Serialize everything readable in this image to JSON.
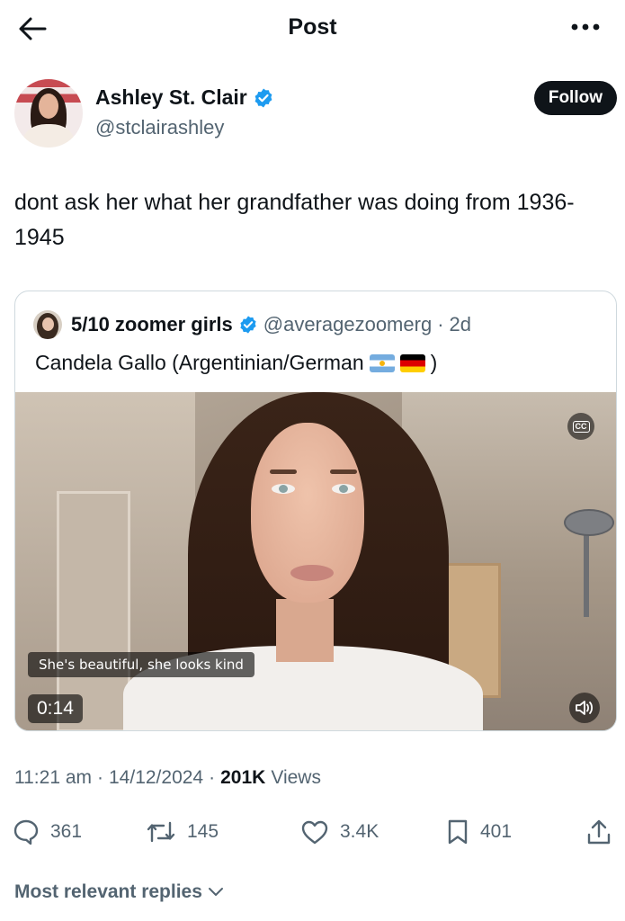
{
  "header": {
    "title": "Post",
    "back_icon": "arrow-left-icon",
    "more_icon": "more-horizontal-icon"
  },
  "author": {
    "name": "Ashley St. Clair",
    "handle": "@stclairashley",
    "verified": true,
    "follow_label": "Follow"
  },
  "post": {
    "text": "dont ask her what her grandfather was doing from 1936-1945"
  },
  "quote": {
    "name": "5/10 zoomer girls",
    "handle": "@averagezoomerg",
    "separator": "·",
    "time": "2d",
    "verified": true,
    "text": "Candela Gallo (Argentinian/German",
    "text_end": ")",
    "flags": [
      "argentina-flag",
      "germany-flag"
    ],
    "video": {
      "cc_label": "CC",
      "caption": "She's beautiful, she looks kind",
      "duration": "0:14"
    }
  },
  "meta": {
    "time": "11:21 am",
    "sep1": "·",
    "date": "14/12/2024",
    "sep2": "·",
    "views_count": "201K",
    "views_label": "Views"
  },
  "actions": {
    "replies": "361",
    "reposts": "145",
    "likes": "3.4K",
    "bookmarks": "401"
  },
  "replies_sort": {
    "label": "Most relevant replies"
  },
  "colors": {
    "text_primary": "#0f1419",
    "text_secondary": "#536471",
    "verified_blue": "#1d9bf0",
    "border": "#cfd9de",
    "follow_bg": "#0f1419"
  }
}
